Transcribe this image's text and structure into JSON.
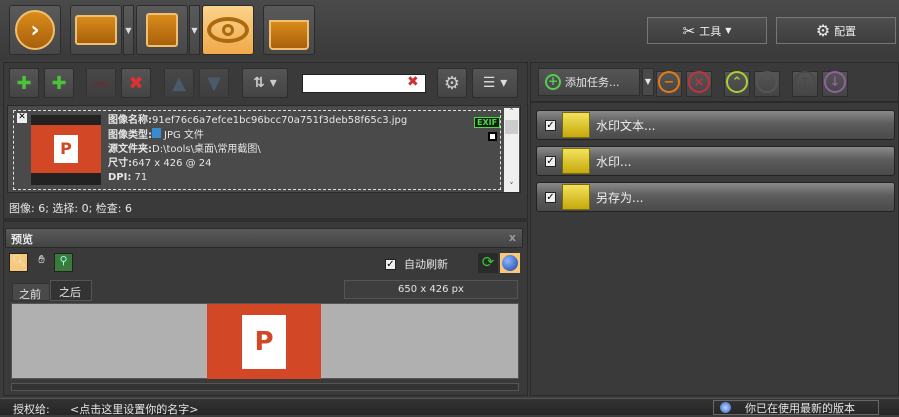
{
  "toolbar": {
    "tools_label": "工具",
    "config_label": "配置"
  },
  "search": {
    "value": "",
    "placeholder": ""
  },
  "image_info": {
    "name_label": "图像名称:",
    "name": "91ef76c6a7efce1bc96bcc70a751f3deb58f65c3.jpg",
    "type_label": "图像类型:",
    "type": "JPG 文件",
    "folder_label": "源文件夹:",
    "folder": "D:\\tools\\桌面\\常用截图\\",
    "size_label": "尺寸:",
    "size": "647 x 426 @ 24",
    "dpi_label": "DPI:",
    "dpi": "71",
    "exif": "EXIF"
  },
  "status": "图像: 6; 选择: 0; 检查: 6",
  "preview": {
    "title": "预览",
    "close": "x",
    "auto_refresh": "自动刷新",
    "tabs": [
      "之前",
      "之后"
    ],
    "dimensions": "650 x 426 px"
  },
  "tasks": {
    "add_label": "添加任务...",
    "items": [
      {
        "label": "水印文本...",
        "checked": true
      },
      {
        "label": "水印...",
        "checked": true
      },
      {
        "label": "另存为...",
        "checked": true
      }
    ]
  },
  "footer": {
    "license_label": "授权给:",
    "license_value": "<点击这里设置你的名字>",
    "version_status": "你已在使用最新的版本"
  }
}
